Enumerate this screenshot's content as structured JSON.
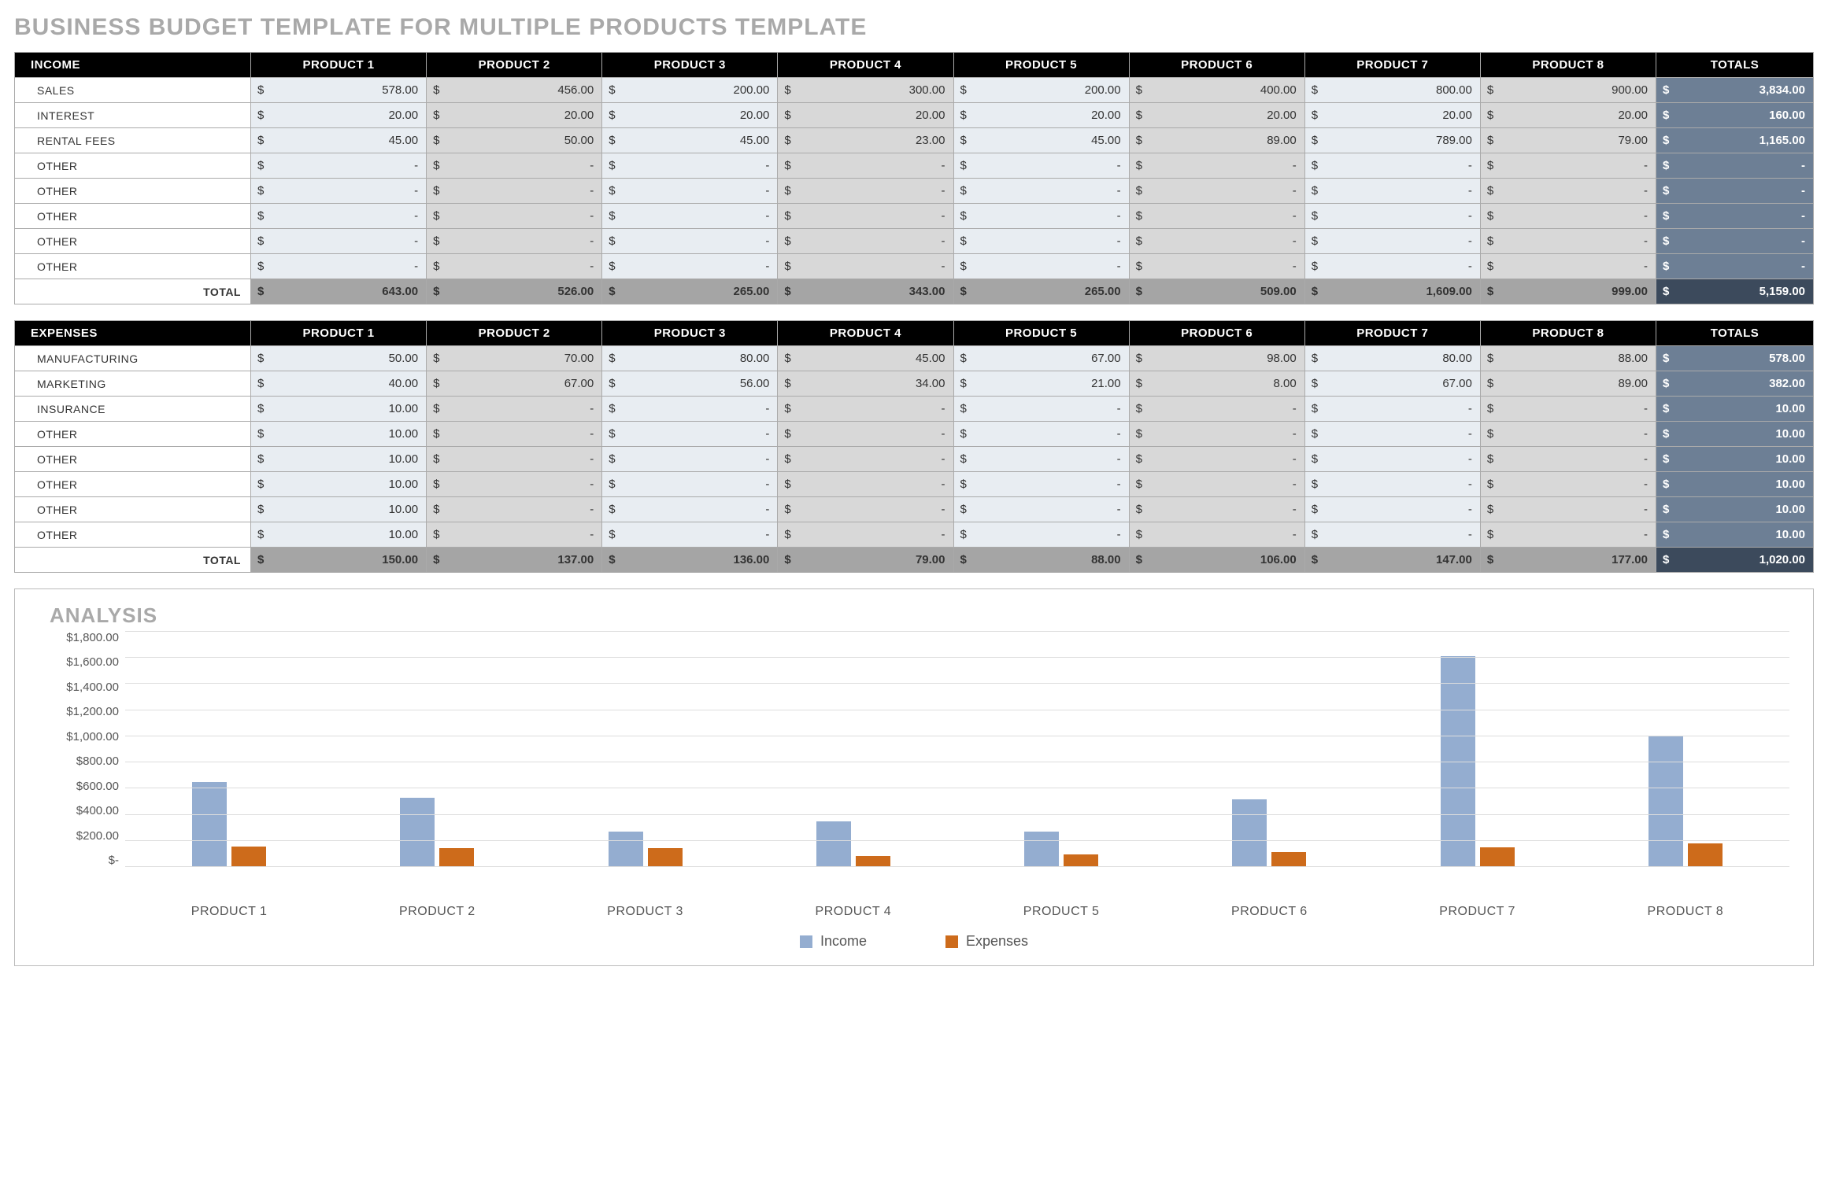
{
  "page_title": "BUSINESS BUDGET TEMPLATE FOR MULTIPLE PRODUCTS TEMPLATE",
  "currency_symbol": "$",
  "dash": "-",
  "products": [
    "PRODUCT 1",
    "PRODUCT 2",
    "PRODUCT 3",
    "PRODUCT 4",
    "PRODUCT 5",
    "PRODUCT 6",
    "PRODUCT 7",
    "PRODUCT 8"
  ],
  "totals_label": "TOTALS",
  "total_row_label": "TOTAL",
  "income": {
    "header": "INCOME",
    "rows": [
      {
        "label": "SALES",
        "values": [
          "578.00",
          "456.00",
          "200.00",
          "300.00",
          "200.00",
          "400.00",
          "800.00",
          "900.00"
        ],
        "total": "3,834.00"
      },
      {
        "label": "INTEREST",
        "values": [
          "20.00",
          "20.00",
          "20.00",
          "20.00",
          "20.00",
          "20.00",
          "20.00",
          "20.00"
        ],
        "total": "160.00"
      },
      {
        "label": "RENTAL FEES",
        "values": [
          "45.00",
          "50.00",
          "45.00",
          "23.00",
          "45.00",
          "89.00",
          "789.00",
          "79.00"
        ],
        "total": "1,165.00"
      },
      {
        "label": "OTHER",
        "values": [
          "-",
          "-",
          "-",
          "-",
          "-",
          "-",
          "-",
          "-"
        ],
        "total": "-"
      },
      {
        "label": "OTHER",
        "values": [
          "-",
          "-",
          "-",
          "-",
          "-",
          "-",
          "-",
          "-"
        ],
        "total": "-"
      },
      {
        "label": "OTHER",
        "values": [
          "-",
          "-",
          "-",
          "-",
          "-",
          "-",
          "-",
          "-"
        ],
        "total": "-"
      },
      {
        "label": "OTHER",
        "values": [
          "-",
          "-",
          "-",
          "-",
          "-",
          "-",
          "-",
          "-"
        ],
        "total": "-"
      },
      {
        "label": "OTHER",
        "values": [
          "-",
          "-",
          "-",
          "-",
          "-",
          "-",
          "-",
          "-"
        ],
        "total": "-"
      }
    ],
    "column_totals": [
      "643.00",
      "526.00",
      "265.00",
      "343.00",
      "265.00",
      "509.00",
      "1,609.00",
      "999.00"
    ],
    "grand_total": "5,159.00"
  },
  "expenses": {
    "header": "EXPENSES",
    "rows": [
      {
        "label": "MANUFACTURING",
        "values": [
          "50.00",
          "70.00",
          "80.00",
          "45.00",
          "67.00",
          "98.00",
          "80.00",
          "88.00"
        ],
        "total": "578.00"
      },
      {
        "label": "MARKETING",
        "values": [
          "40.00",
          "67.00",
          "56.00",
          "34.00",
          "21.00",
          "8.00",
          "67.00",
          "89.00"
        ],
        "total": "382.00"
      },
      {
        "label": "INSURANCE",
        "values": [
          "10.00",
          "-",
          "-",
          "-",
          "-",
          "-",
          "-",
          "-"
        ],
        "total": "10.00"
      },
      {
        "label": "OTHER",
        "values": [
          "10.00",
          "-",
          "-",
          "-",
          "-",
          "-",
          "-",
          "-"
        ],
        "total": "10.00"
      },
      {
        "label": "OTHER",
        "values": [
          "10.00",
          "-",
          "-",
          "-",
          "-",
          "-",
          "-",
          "-"
        ],
        "total": "10.00"
      },
      {
        "label": "OTHER",
        "values": [
          "10.00",
          "-",
          "-",
          "-",
          "-",
          "-",
          "-",
          "-"
        ],
        "total": "10.00"
      },
      {
        "label": "OTHER",
        "values": [
          "10.00",
          "-",
          "-",
          "-",
          "-",
          "-",
          "-",
          "-"
        ],
        "total": "10.00"
      },
      {
        "label": "OTHER",
        "values": [
          "10.00",
          "-",
          "-",
          "-",
          "-",
          "-",
          "-",
          "-"
        ],
        "total": "10.00"
      }
    ],
    "column_totals": [
      "150.00",
      "137.00",
      "136.00",
      "79.00",
      "88.00",
      "106.00",
      "147.00",
      "177.00"
    ],
    "grand_total": "1,020.00"
  },
  "analysis_title": "ANALYSIS",
  "legend": {
    "income": "Income",
    "expenses": "Expenses"
  },
  "chart_data": {
    "type": "bar",
    "title": "ANALYSIS",
    "xlabel": "",
    "ylabel": "",
    "categories": [
      "PRODUCT 1",
      "PRODUCT 2",
      "PRODUCT 3",
      "PRODUCT 4",
      "PRODUCT 5",
      "PRODUCT 6",
      "PRODUCT 7",
      "PRODUCT 8"
    ],
    "series": [
      {
        "name": "Income",
        "values": [
          643,
          526,
          265,
          343,
          265,
          509,
          1609,
          999
        ],
        "color": "#94add0"
      },
      {
        "name": "Expenses",
        "values": [
          150,
          137,
          136,
          79,
          88,
          106,
          147,
          177
        ],
        "color": "#cd6b1b"
      }
    ],
    "ylim": [
      0,
      1800
    ],
    "yticks": [
      "$-",
      "$200.00",
      "$400.00",
      "$600.00",
      "$800.00",
      "$1,000.00",
      "$1,200.00",
      "$1,400.00",
      "$1,600.00",
      "$1,800.00"
    ]
  }
}
